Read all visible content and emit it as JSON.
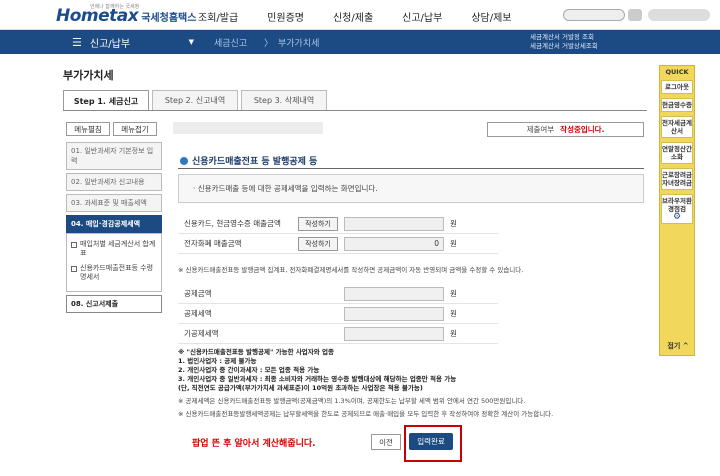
{
  "header": {
    "tagline": "언제나 함께하는 국세청",
    "logo_main": "Hometax",
    "logo_org": "국세청홈택스",
    "menu": [
      "조회/발급",
      "민원증명",
      "신청/제출",
      "신고/납부",
      "상담/제보"
    ]
  },
  "nav": {
    "home_label": "신고/납부",
    "crumbs": [
      "세금신고",
      "부가가치세"
    ],
    "right_notice": [
      "세금계산서 거발정 조회",
      "세금계산서 거발상세조회"
    ]
  },
  "page": {
    "title": "부가가치세",
    "tabs": [
      "Step 1. 세금신고",
      "Step 2. 신고내역",
      "Step 3. 삭제내역"
    ]
  },
  "left": {
    "buttons": [
      "메뉴펼침",
      "메뉴접기"
    ],
    "steps": [
      "01. 일반과세자 기본정보 입력",
      "02. 일반과세자 신고내용",
      "03. 과세표준 및 매출세액",
      "04. 매입·경감공제세액"
    ],
    "subitems": [
      "매입처별 세금계산서 합계표",
      "신용카드매출전표등 수령명세서"
    ],
    "last_step": "08. 신고서제출"
  },
  "status": {
    "label": "제출여부",
    "value": "작성중입니다."
  },
  "section": {
    "title": "신용카드매출전표 등 발행공제 등",
    "info": "· 신용카드매출 등에 대한 공제세액을 입력하는 화면입니다.",
    "unit": "원",
    "write_label": "작성하기",
    "rows_top": [
      {
        "label": "신용카드, 현금영수증 매출금액",
        "value": ""
      },
      {
        "label": "전자화폐 매출금액",
        "value": "0"
      }
    ],
    "top_note": "※ 신용카드매출전표등 발행금액 집계표, 전자화폐결제명세서를 작성하면 공제금액이 자동 반영되며 금액을 수정할 수 있습니다.",
    "rows_bottom": [
      {
        "label": "공제금액",
        "value": ""
      },
      {
        "label": "공제세액",
        "value": ""
      },
      {
        "label": "기공제세액",
        "value": ""
      }
    ],
    "notes": [
      "※ \"신용카드매출전표등 발행공제\" 가능한 사업자와 업종",
      "   1. 법인사업자 : 공제 불가능",
      "   2. 개인사업자 중 간이과세자 : 모든 업종 적용 가능",
      "   3. 개인사업자 중 일반과세자 : 최종 소비자와 거래하는 영수증 발행대상에 해당하는 업종만 적용 가능",
      "      (단, 직전연도 공급가액(부가가치세 과세표준)이 10억원 초과하는 사업장은 적용 불가능)",
      "※ 공제세액은 신용카드매출전표등 발행금액(공제금액)의 1.3%이며, 공제한도는 납부할 세액 범위 안에서 연간 500만원입니다.",
      "※ 신용카드매출전표등발행세액공제는 납부할세액을 한도로 공제되므로 매출·매입을 모두 입력한 후 작성하여야 정확한 계산이 가능합니다."
    ]
  },
  "footer": {
    "popup_note": "팝업 뜬 후 알아서 계산해줍니다.",
    "prev": "이전",
    "done": "입력완료"
  },
  "quick": {
    "head": "QUICK",
    "items": [
      "로그아웃",
      "현금영수증",
      "전자세금계산서",
      "연말정산간소화",
      "근로장려금자녀장려금",
      "브라우저환경점검"
    ],
    "close": "접기"
  },
  "colors": {
    "brand": "#1c4a82",
    "alert": "#d60000",
    "quick_bg": "#f1d75c"
  }
}
